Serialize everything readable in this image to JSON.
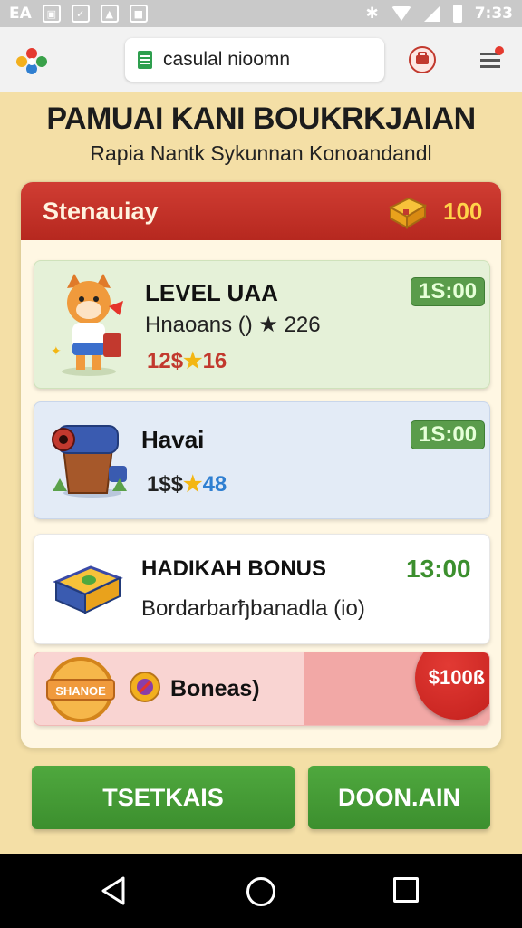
{
  "status_bar": {
    "left_text": "EA",
    "time": "7:33",
    "bluetooth_glyph": "✱"
  },
  "browser": {
    "url": "casulal nioomn"
  },
  "header": {
    "title": "PAMUAI KANI BOUKRKJAIAN",
    "subtitle": "Rapia Nantk Sykunnan Konoandandl"
  },
  "panel": {
    "title": "Stenauiay",
    "chest_count": "100",
    "cards": [
      {
        "name": "LEVEL UAA",
        "desc": "Hnaoans () ★ 226",
        "score_left": "12$",
        "score_star": "★",
        "score_right": "16",
        "time": "1S:00"
      },
      {
        "name": "Havai",
        "score_left": "1$$",
        "score_star": "★",
        "score_right": "48",
        "time": "1S:00"
      },
      {
        "name": "HADIKAH BONUS",
        "desc": "Bordarbarђbanadla (io)",
        "time": "13:00"
      },
      {
        "badge_text": "SHANOE",
        "name": "Boneas)",
        "amount": "$100ß"
      }
    ]
  },
  "buttons": {
    "left": "TSETKAIS",
    "right": "DOON.AIN"
  },
  "colors": {
    "background": "#f4dfa6",
    "header_red": "#c8332a",
    "green": "#47a039",
    "bonus_red": "#d02a24"
  }
}
